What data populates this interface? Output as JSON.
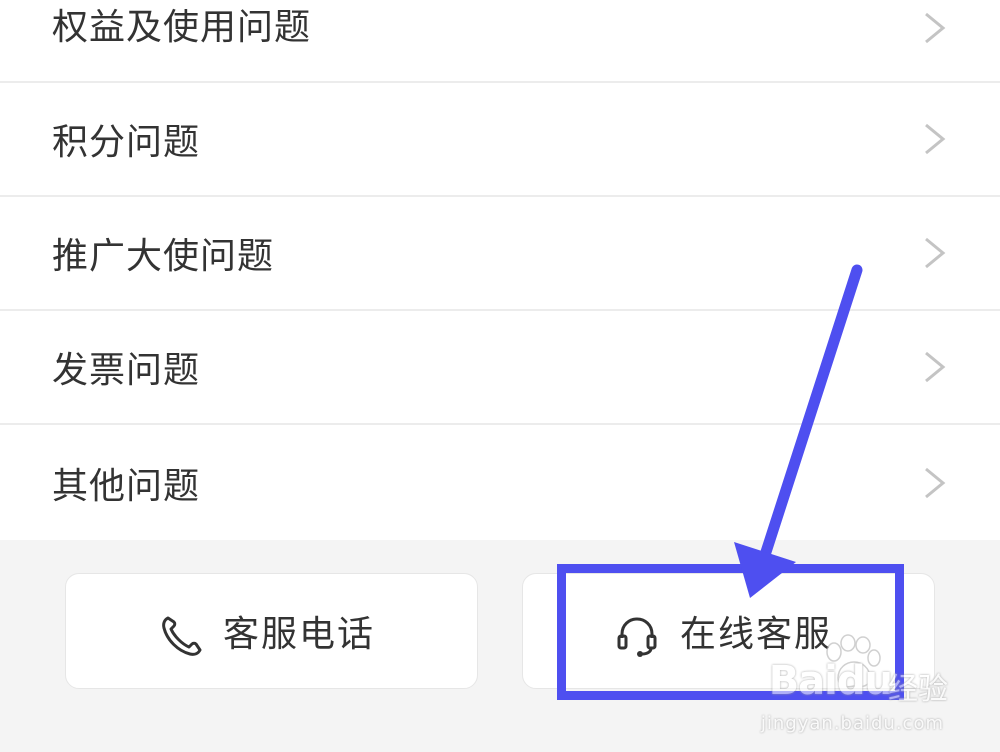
{
  "faq_list": {
    "items": [
      {
        "label": "权益及使用问题"
      },
      {
        "label": "积分问题"
      },
      {
        "label": "推广大使问题"
      },
      {
        "label": "发票问题"
      },
      {
        "label": "其他问题"
      }
    ]
  },
  "footer": {
    "phone_button": {
      "label": "客服电话",
      "icon": "phone-icon"
    },
    "online_button": {
      "label": "在线客服",
      "icon": "headset-icon"
    }
  },
  "annotation": {
    "color": "#4e4ff0"
  },
  "watermark": {
    "logo": "Baidu",
    "sub": "经验",
    "url": "jingyan.baidu.com"
  }
}
